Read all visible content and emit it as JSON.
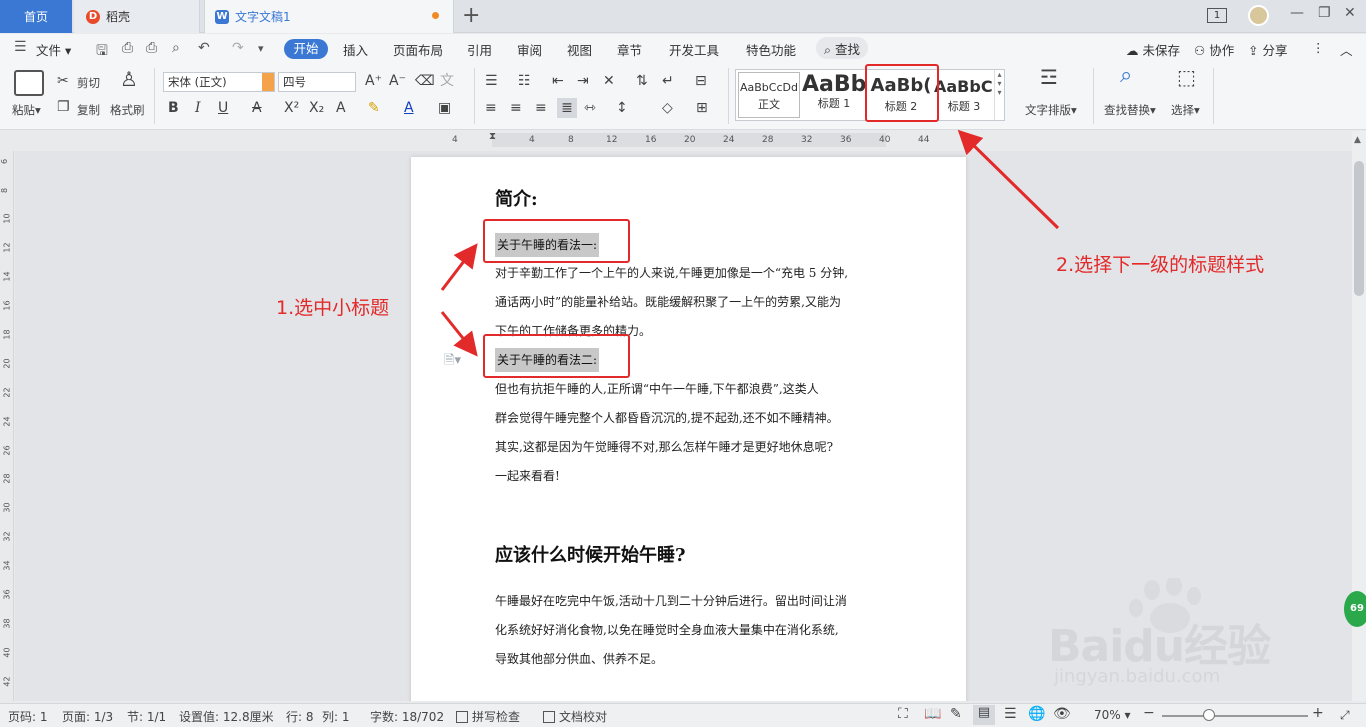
{
  "titlebar": {
    "tabs": [
      {
        "label": "首页"
      },
      {
        "label": "稻壳"
      },
      {
        "label": "文字文稿1"
      }
    ],
    "page_badge": "1"
  },
  "menubar": {
    "file": "文件",
    "items": [
      "开始",
      "插入",
      "页面布局",
      "引用",
      "审阅",
      "视图",
      "章节",
      "开发工具",
      "特色功能"
    ],
    "search": "查找",
    "unsaved": "未保存",
    "collaborate": "协作",
    "share": "分享"
  },
  "ribbon": {
    "paste": "粘贴",
    "cut": "剪切",
    "copy": "复制",
    "format_painter": "格式刷",
    "font_name": "宋体 (正文)",
    "font_size": "四号",
    "styles": [
      {
        "sample": "AaBbCcDd",
        "label": "正文"
      },
      {
        "sample": "AaBb",
        "label": "标题 1"
      },
      {
        "sample": "AaBb(",
        "label": "标题 2"
      },
      {
        "sample": "AaBbC(",
        "label": "标题 3"
      }
    ],
    "text_layout": "文字排版",
    "find_replace": "查找替换",
    "select": "选择"
  },
  "ruler": {
    "h_marks": [
      "4",
      "4",
      "8",
      "12",
      "16",
      "20",
      "24",
      "28",
      "32",
      "36",
      "40",
      "44"
    ],
    "v_marks": [
      "6",
      "8",
      "10",
      "12",
      "14",
      "16",
      "18",
      "20",
      "22",
      "24",
      "26",
      "28",
      "30",
      "32",
      "34",
      "36",
      "38",
      "40",
      "42"
    ]
  },
  "document": {
    "heading1": "简介:",
    "sub1": "关于午睡的看法一:",
    "para1": [
      "对于辛勤工作了一个上午的人来说,午睡更加像是一个“充电 5 分钟,",
      "通话两小时”的能量补给站。既能缓解积聚了一上午的劳累,又能为",
      "下午的工作储备更多的精力。"
    ],
    "sub2": "关于午睡的看法二:",
    "para2": [
      "但也有抗拒午睡的人,正所谓“中午一午睡,下午都浪费”,这类人",
      "群会觉得午睡完整个人都昏昏沉沉的,提不起劲,还不如不睡精神。",
      "其实,这都是因为午觉睡得不对,那么怎样午睡才是更好地休息呢?",
      "一起来看看!"
    ],
    "heading2": "应该什么时候开始午睡?",
    "para3": [
      "午睡最好在吃完中午饭,活动十几到二十分钟后进行。留出时间让消",
      "化系统好好消化食物,以免在睡觉时全身血液大量集中在消化系统,",
      "导致其他部分供血、供养不足。"
    ]
  },
  "annotations": {
    "step1": "1.选中小标题",
    "step2": "2.选择下一级的标题样式",
    "color": "#e32a2a"
  },
  "statusbar": {
    "page_no": "页码: 1",
    "pages": "页面: 1/3",
    "section": "节: 1/1",
    "setting": "设置值: 12.8厘米",
    "row": "行: 8",
    "col": "列: 1",
    "words": "字数: 18/702",
    "spell": "拼写检查",
    "proof": "文档校对",
    "zoom": "70%"
  },
  "watermark": {
    "brand": "Baidu经验",
    "url": "jingyan.baidu.com"
  },
  "badge": "69",
  "colors": {
    "accent": "#3a78d4",
    "annotation": "#e32a2a",
    "highlight": "#c8c8c8"
  }
}
